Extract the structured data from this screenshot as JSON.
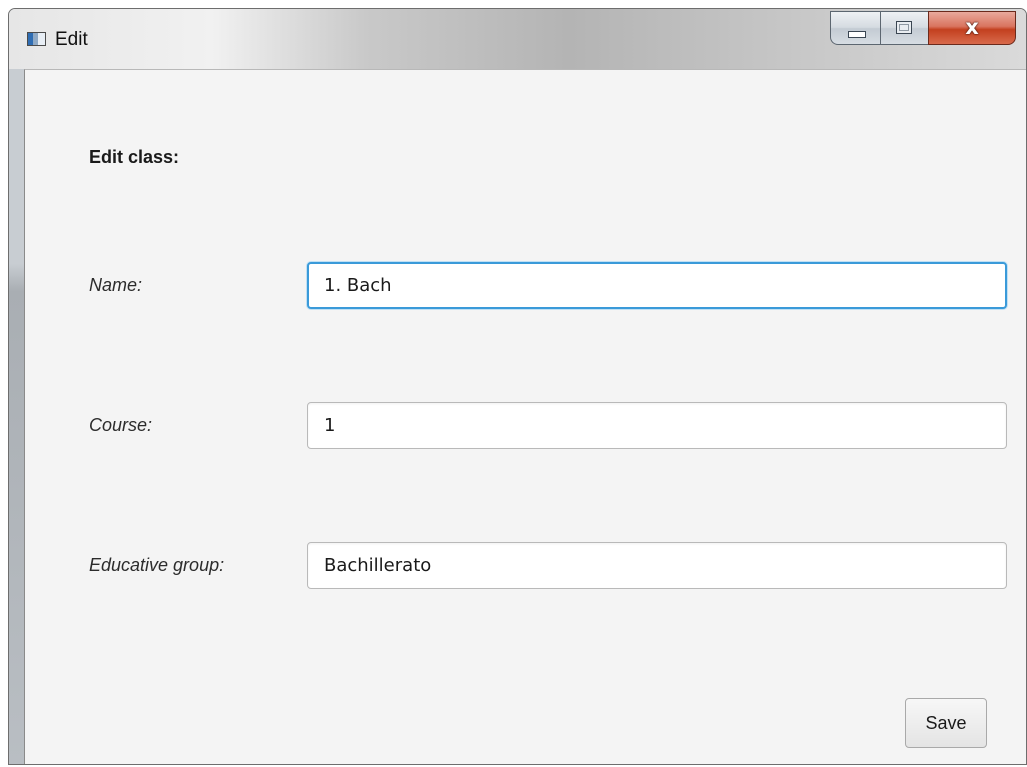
{
  "window": {
    "title": "Edit",
    "icon": "app-window-icon",
    "controls": {
      "minimize_icon": "minimize-icon",
      "maximize_icon": "maximize-icon",
      "close_glyph": "x"
    }
  },
  "form": {
    "heading": "Edit class:",
    "fields": [
      {
        "label": "Name:",
        "value": "1. Bach",
        "focused": true
      },
      {
        "label": "Course:",
        "value": "1",
        "focused": false
      },
      {
        "label": "Educative group:",
        "value": "Bachillerato",
        "focused": false
      }
    ],
    "save_label": "Save"
  },
  "colors": {
    "focus_border": "#3a9ad9",
    "close_button": "#c3401f",
    "client_background": "#f4f4f4"
  }
}
